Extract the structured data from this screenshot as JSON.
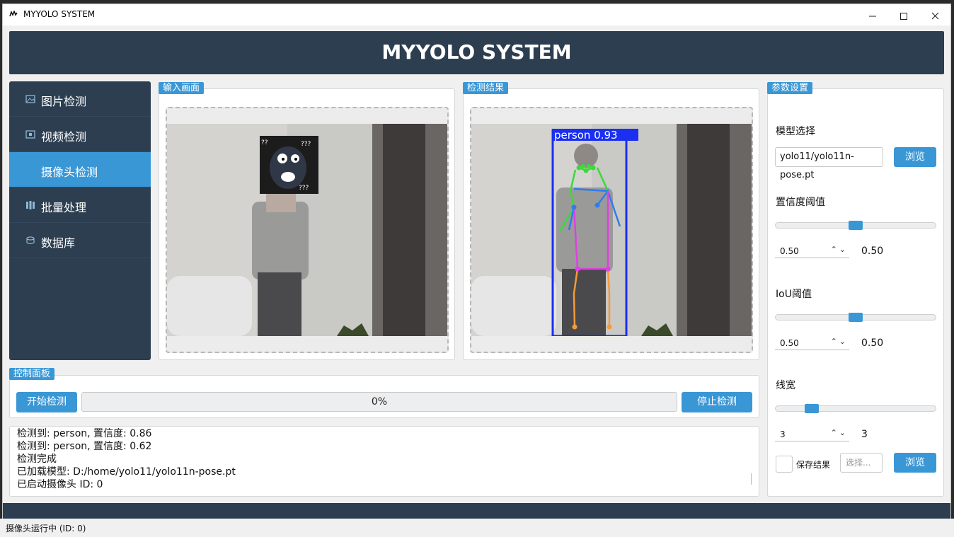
{
  "window": {
    "title": "MYYOLO SYSTEM"
  },
  "header": {
    "title": "MYYOLO SYSTEM"
  },
  "sidebar": {
    "items": [
      {
        "label": "图片检测",
        "icon": "image-icon",
        "active": false
      },
      {
        "label": "视频检测",
        "icon": "video-icon",
        "active": false
      },
      {
        "label": "摄像头检测",
        "icon": "camera-icon",
        "active": true
      },
      {
        "label": "批量处理",
        "icon": "batch-icon",
        "active": false
      },
      {
        "label": "数据库",
        "icon": "database-icon",
        "active": false
      }
    ]
  },
  "panels": {
    "input_title": "输入画面",
    "result_title": "检测结果",
    "detection_label": "person  0.93"
  },
  "control": {
    "title": "控制面板",
    "start_label": "开始检测",
    "progress_text": "0%",
    "progress_value": 0,
    "stop_label": "停止检测"
  },
  "log": {
    "lines": [
      "检测到: person, 置信度: 0.86",
      "检测到: person, 置信度: 0.62",
      "检测完成",
      "已加载模型: D:/home/yolo11/yolo11n-pose.pt",
      "已启动摄像头 ID: 0"
    ]
  },
  "settings": {
    "title": "参数设置",
    "model_label": "模型选择",
    "model_value": "yolo11/yolo11n-pose.pt",
    "browse_label": "浏览",
    "conf_label": "置信度阈值",
    "conf_spin": "0.50",
    "conf_value": "0.50",
    "conf_level": 0.5,
    "iou_label": "IoU阈值",
    "iou_spin": "0.50",
    "iou_value": "0.50",
    "iou_level": 0.5,
    "line_label": "线宽",
    "line_spin": "3",
    "line_value": "3",
    "line_level": 0.2,
    "save_label": "保存结果",
    "choose_placeholder": "选择...",
    "browse2_label": "浏览"
  },
  "status": {
    "text": "摄像头运行中 (ID: 0)"
  },
  "colors": {
    "accent": "#3a97d6",
    "dark": "#2c3e50",
    "box": "#1a2ff0"
  }
}
